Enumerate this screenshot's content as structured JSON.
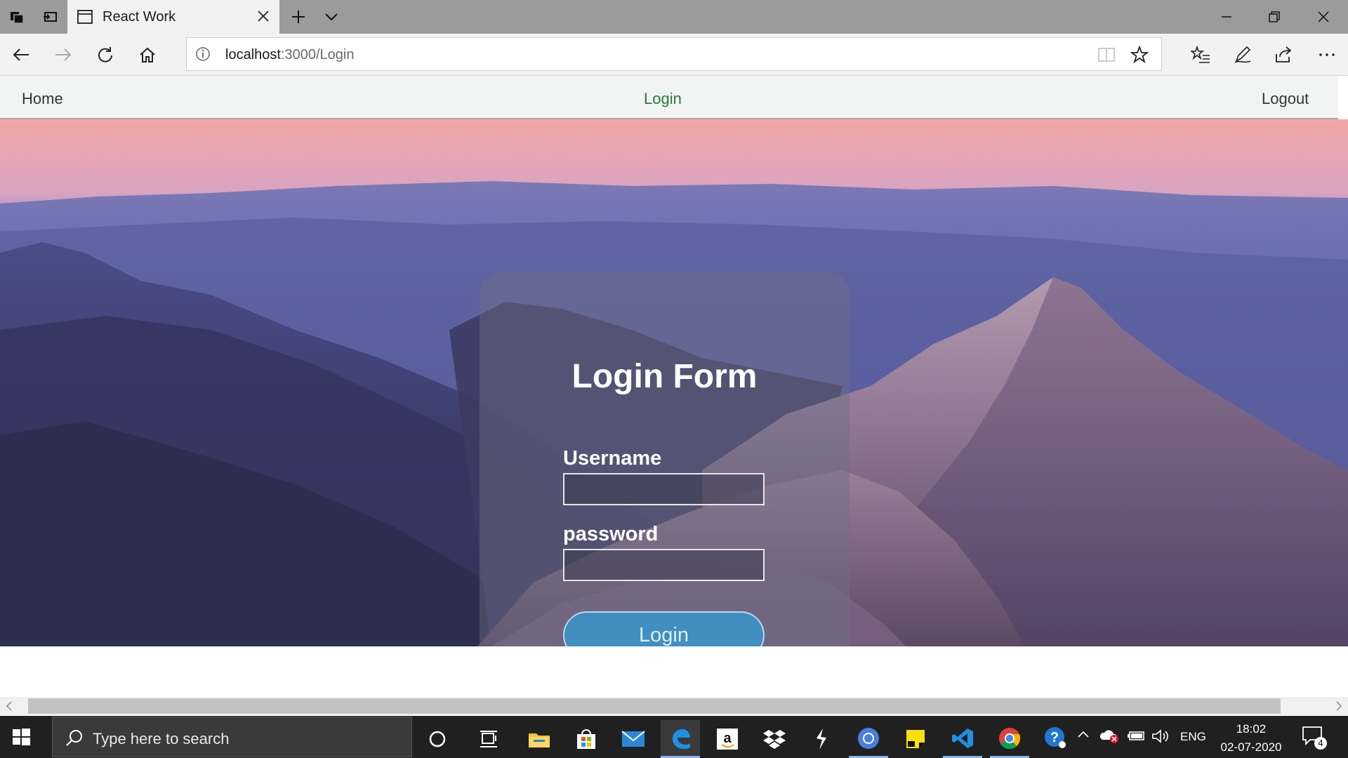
{
  "browser": {
    "tab_title": "React Work",
    "url_host": "localhost",
    "url_rest": ":3000/Login"
  },
  "nav": {
    "home": "Home",
    "login": "Login",
    "logout": "Logout"
  },
  "login_form": {
    "title": "Login Form",
    "username_label": "Username",
    "username_value": "",
    "password_label": "password",
    "password_value": "",
    "submit_label": "Login"
  },
  "taskbar": {
    "search_placeholder": "Type here to search",
    "language": "ENG",
    "time": "18:02",
    "date": "02-07-2020",
    "notification_count": "4"
  },
  "colors": {
    "nav_active": "#2d7a2d",
    "button": "#3896cd"
  }
}
